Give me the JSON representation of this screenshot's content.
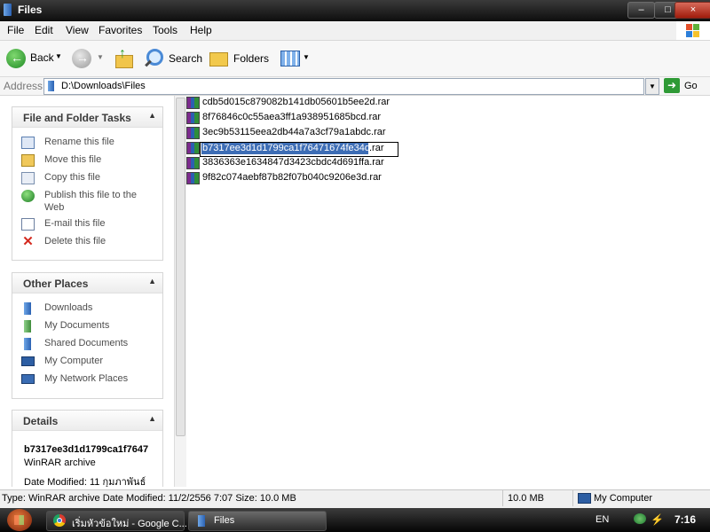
{
  "window": {
    "title": "Files",
    "buttons": {
      "minimize": "–",
      "maximize": "□",
      "close": "×"
    }
  },
  "menu": [
    "File",
    "Edit",
    "View",
    "Favorites",
    "Tools",
    "Help"
  ],
  "toolbar": {
    "back": "Back",
    "search": "Search",
    "folders": "Folders"
  },
  "address": {
    "label": "Address",
    "path": "D:\\Downloads\\Files",
    "go": "Go"
  },
  "tasks_panel": {
    "title": "File and Folder Tasks",
    "items": [
      {
        "label": "Rename this file",
        "icon": "rename-icon"
      },
      {
        "label": "Move this file",
        "icon": "move-icon"
      },
      {
        "label": "Copy this file",
        "icon": "copy-icon"
      },
      {
        "label": "Publish this file to the",
        "label2": "Web",
        "icon": "publish-icon"
      },
      {
        "label": "E-mail this file",
        "icon": "email-icon"
      },
      {
        "label": "Delete this file",
        "icon": "delete-icon"
      }
    ]
  },
  "places_panel": {
    "title": "Other Places",
    "items": [
      "Downloads",
      "My Documents",
      "Shared Documents",
      "My Computer",
      "My Network Places"
    ]
  },
  "details_panel": {
    "title": "Details",
    "name": "b7317ee3d1d1799ca1f7647",
    "type": "WinRAR archive",
    "modified": "Date Modified: 11 กุมภาพันธ์"
  },
  "files": [
    {
      "name": "cdb5d015c879082b141db05601b5ee2d.rar"
    },
    {
      "name": "8f76846c0c55aea3ff1a938951685bcd.rar"
    },
    {
      "name": "3ec9b53115eea2db44a7a3cf79a1abdc.rar"
    },
    {
      "name": "b7317ee3d1d1799ca1f76471674fe34d",
      "ext": ".rar",
      "renaming": true
    },
    {
      "name": "3836363e1634847d3423cbdc4d691ffa.rar"
    },
    {
      "name": "9f82c074aebf87b82f07b040c9206e3d.rar"
    }
  ],
  "status": {
    "info": "Type: WinRAR archive Date Modified: 11/2/2556 7:07 Size: 10.0 MB",
    "size": "10.0 MB",
    "location": "My Computer"
  },
  "taskbar": {
    "items": [
      {
        "label": "เริ่มหัวข้อใหม่ - Google C..."
      },
      {
        "label": "Files"
      }
    ],
    "lang": "EN",
    "clock": "7:16"
  },
  "colors": {
    "titlebar": "#1a1a1a",
    "link": "#4d4d4d",
    "selection": "#3d6db5",
    "go_green": "#2f9a36"
  }
}
